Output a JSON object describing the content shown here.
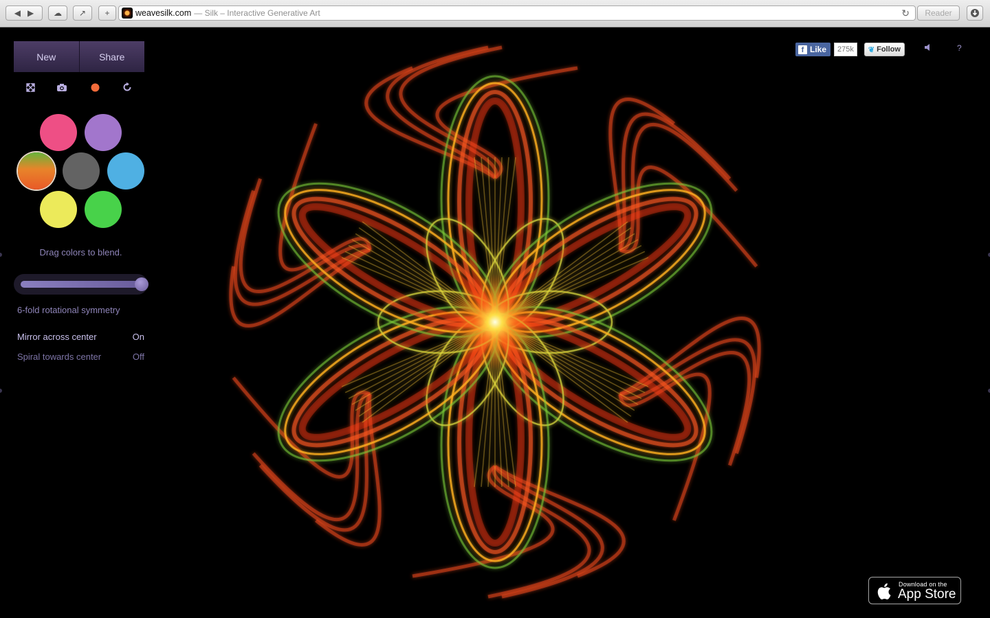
{
  "browser": {
    "host": "weavesilk.com",
    "title_suffix": "— Silk – Interactive Generative Art",
    "reader_label": "Reader"
  },
  "panel": {
    "new_label": "New",
    "share_label": "Share",
    "tools": [
      "fullscreen-icon",
      "camera-icon",
      "record-dot-icon",
      "undo-icon"
    ],
    "swatches": [
      {
        "name": "pink",
        "color": "#ee4f85"
      },
      {
        "name": "purple",
        "color": "#a276cc"
      },
      {
        "name": "orange-green-blend",
        "color": "#e85a28",
        "selected": true
      },
      {
        "name": "gray",
        "color": "#636363"
      },
      {
        "name": "blue",
        "color": "#4fb0e3"
      },
      {
        "name": "yellow",
        "color": "#ecea5a"
      },
      {
        "name": "green",
        "color": "#48d24a"
      }
    ],
    "hint": "Drag colors to blend.",
    "symmetry_level": 1.0,
    "symmetry_label": "6-fold rotational symmetry",
    "mirror_label": "Mirror across center",
    "mirror_value": "On",
    "spiral_label": "Spiral towards center",
    "spiral_value": "Off"
  },
  "social": {
    "like_label": "Like",
    "like_count": "275k",
    "follow_label": "Follow"
  },
  "help_label": "?",
  "appstore": {
    "line1": "Download on the",
    "line2": "App Store"
  },
  "colors": {
    "accent": "#4d3d66",
    "text_muted": "#8e84b8"
  }
}
